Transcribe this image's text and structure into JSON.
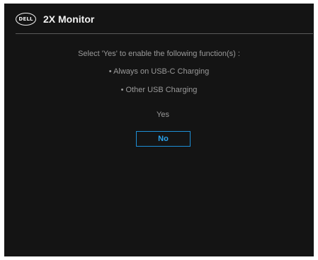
{
  "header": {
    "logo_text": "DELL",
    "title": "2X Monitor"
  },
  "dialog": {
    "prompt": "Select 'Yes' to enable the following function(s) :",
    "functions": [
      "• Always on USB-C Charging",
      "• Other USB Charging"
    ],
    "options": {
      "yes_label": "Yes",
      "no_label": "No",
      "selected": "No"
    }
  },
  "colors": {
    "background": "#141414",
    "text_dim": "#9a9a9a",
    "highlight": "#1e8fd6"
  }
}
